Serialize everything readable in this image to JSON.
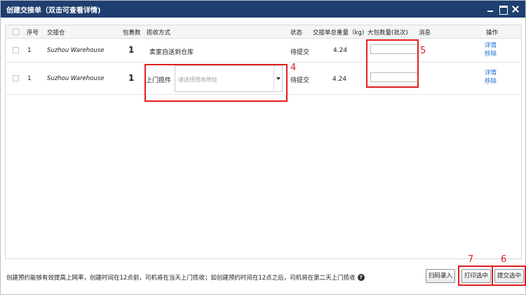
{
  "window": {
    "title": "创建交接单（双击可查看详情)",
    "controls": [
      "minimize-icon",
      "maximize-icon",
      "close-icon"
    ]
  },
  "table": {
    "columns": {
      "seq": "序号",
      "warehouse": "交接仓",
      "packages": "包裹数",
      "pickup": "揽收方式",
      "status": "状态",
      "weight": "交接单总重量（kg)",
      "bigpack": "大包数量(批次)",
      "message": "消息",
      "actions": "操作"
    },
    "rows": [
      {
        "seq": "1",
        "warehouse": "Suzhou Warehouse",
        "packages": "1",
        "pickup": "卖家自送到仓库",
        "status": "待提交",
        "weight": "4.24",
        "bigpack": "",
        "message": "",
        "action_detail": "详情",
        "action_remove": "移除"
      },
      {
        "seq": "1",
        "warehouse": "Suzhou Warehouse",
        "packages": "1",
        "pickup": "上门揽件",
        "pickup_address_placeholder": "请选择揽收地址",
        "status": "待提交",
        "weight": "4.24",
        "bigpack": "",
        "message": "",
        "action_detail": "详情",
        "action_remove": "移除"
      }
    ]
  },
  "annotations": {
    "n4": "4",
    "n5": "5",
    "n6": "6",
    "n7": "7",
    "color": "#e02020"
  },
  "footer": {
    "note": "创建预约能够有效提高上网率，创建时间在12点前，司机将在当天上门揽收；如创建预约时间在12点之后，司机将在第二天上门揽收",
    "help_icon": "question-circle-icon",
    "scan_label": "扫码录入",
    "print_label": "打印选中",
    "submit_label": "提交选中"
  },
  "colors": {
    "titlebar": "#1f3f70",
    "link": "#1a6fd1"
  }
}
